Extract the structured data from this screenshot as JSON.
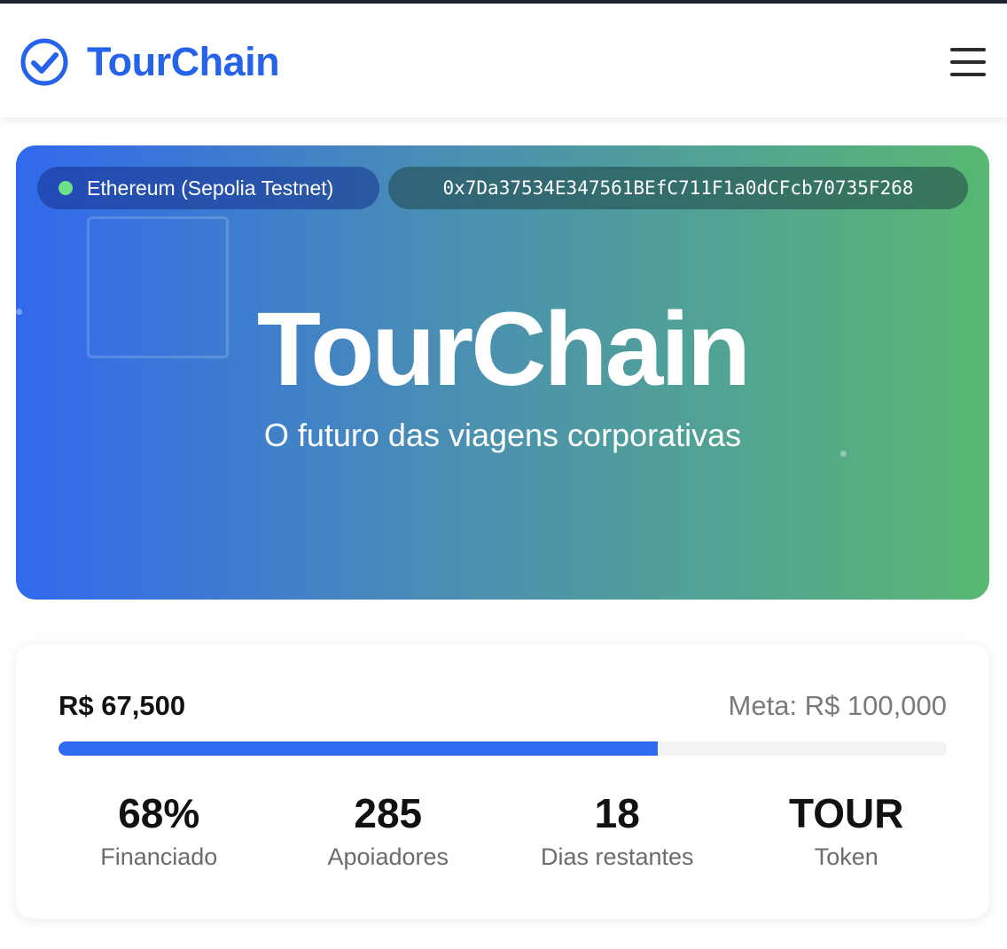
{
  "header": {
    "brand_name": "TourChain",
    "brand_icon": "check-circle-icon",
    "menu_icon": "hamburger-menu-icon",
    "brand_color": "#2563eb"
  },
  "hero": {
    "network_label": "Ethereum (Sepolia Testnet)",
    "network_status_color": "#6ee08a",
    "contract_address": "0x7Da37534E347561BEfC711F1a0dCFcb70735F268",
    "title": "TourChain",
    "subtitle": "O futuro das viagens corporativas",
    "gradient_start": "#3169ec",
    "gradient_end": "#59b872"
  },
  "funding": {
    "raised": "R$ 67,500",
    "goal": "Meta: R$ 100,000",
    "progress_fraction": 0.675,
    "progress_color": "#2f6bef",
    "stats": [
      {
        "value": "68%",
        "label": "Financiado"
      },
      {
        "value": "285",
        "label": "Apoiadores"
      },
      {
        "value": "18",
        "label": "Dias restantes"
      },
      {
        "value": "TOUR",
        "label": "Token"
      }
    ]
  }
}
